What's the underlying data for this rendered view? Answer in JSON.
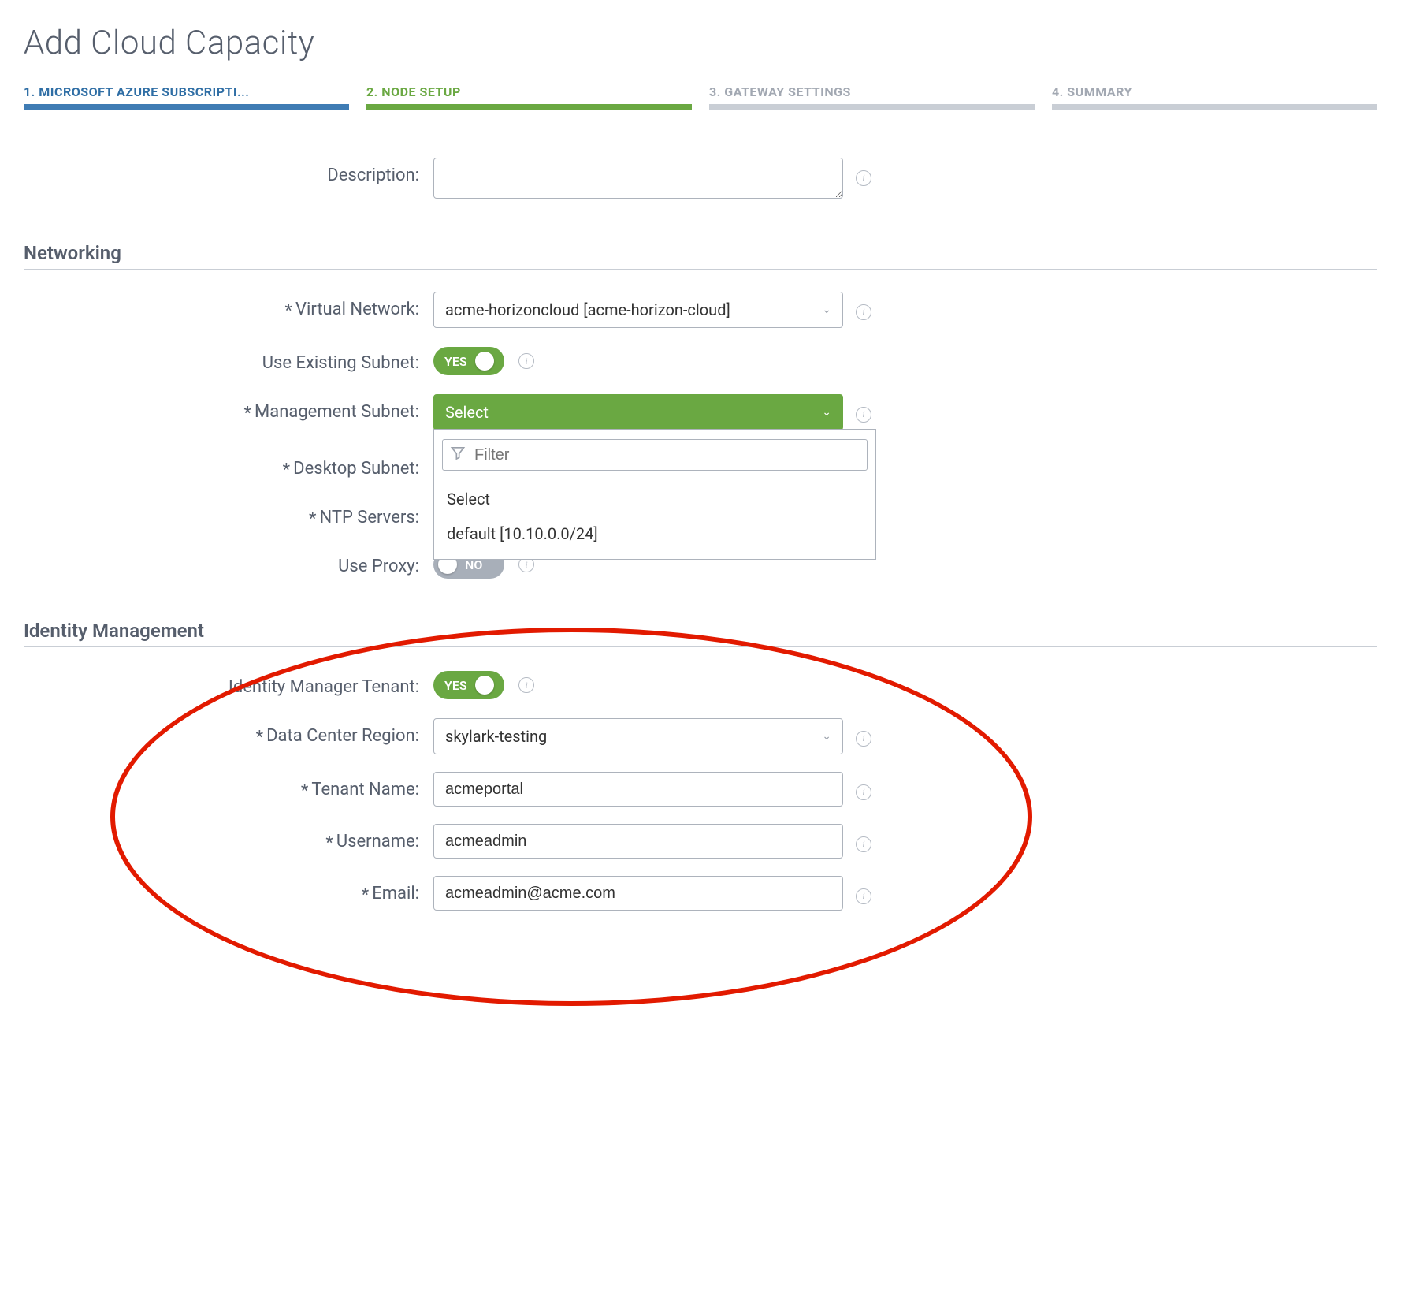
{
  "page_title": "Add Cloud Capacity",
  "steps": [
    {
      "label": "1. MICROSOFT AZURE SUBSCRIPTI...",
      "state": "completed"
    },
    {
      "label": "2. NODE SETUP",
      "state": "active"
    },
    {
      "label": "3. GATEWAY SETTINGS",
      "state": "pending"
    },
    {
      "label": "4. SUMMARY",
      "state": "pending"
    }
  ],
  "description": {
    "label": "Description:",
    "value": ""
  },
  "sections": {
    "networking": {
      "heading": "Networking",
      "virtual_network": {
        "label": "Virtual Network:",
        "value": "acme-horizoncloud [acme-horizon-cloud]"
      },
      "use_existing_subnet": {
        "label": "Use Existing Subnet:",
        "value": "YES",
        "on": true
      },
      "management_subnet": {
        "label": "Management Subnet:",
        "value": "Select",
        "filter_placeholder": "Filter",
        "options": [
          "Select",
          "default [10.10.0.0/24]"
        ]
      },
      "desktop_subnet": {
        "label": "Desktop Subnet:"
      },
      "ntp_servers": {
        "label": "NTP Servers:"
      },
      "use_proxy": {
        "label": "Use Proxy:",
        "value": "NO",
        "on": false
      }
    },
    "identity": {
      "heading": "Identity Management",
      "identity_manager_tenant": {
        "label": "Identity Manager Tenant:",
        "value": "YES",
        "on": true
      },
      "data_center_region": {
        "label": "Data Center Region:",
        "value": "skylark-testing"
      },
      "tenant_name": {
        "label": "Tenant Name:",
        "value": "acmeportal"
      },
      "username": {
        "label": "Username:",
        "value": "acmeadmin"
      },
      "email": {
        "label": "Email:",
        "value": "acmeadmin@acme.com"
      }
    }
  }
}
